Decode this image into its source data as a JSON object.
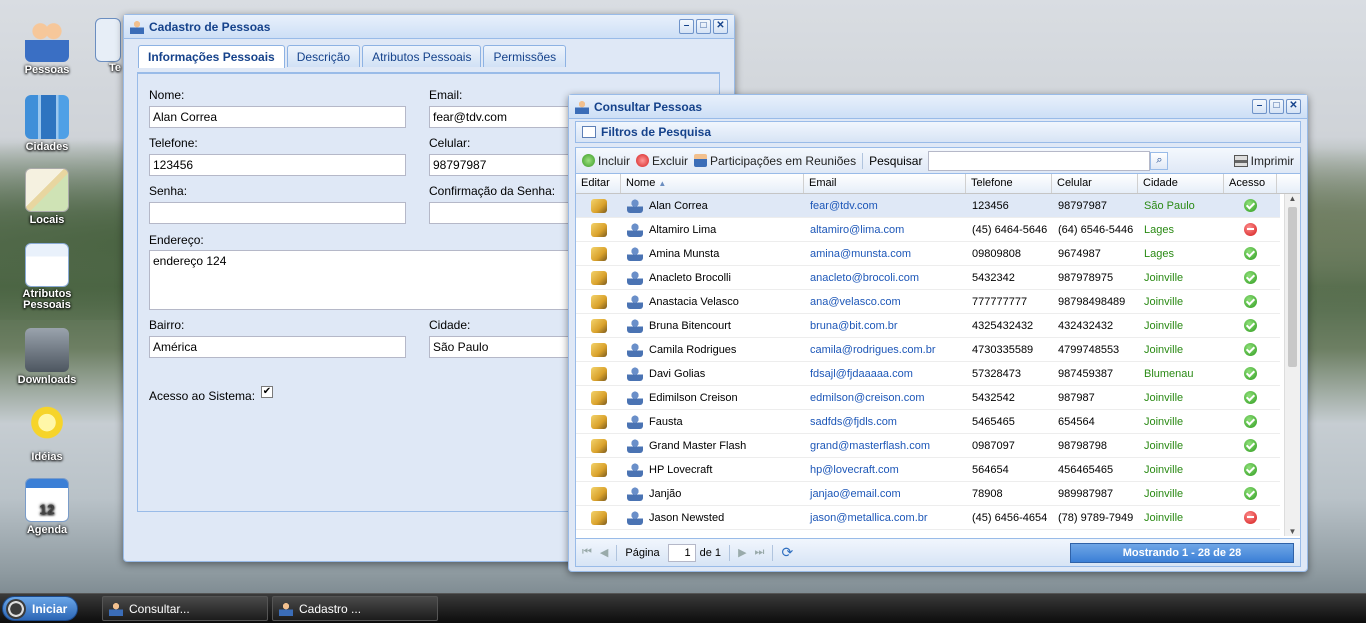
{
  "desktop": {
    "icons": [
      {
        "label": "Pessoas"
      },
      {
        "label": "Cidades"
      },
      {
        "label": "Locais"
      },
      {
        "label": "Atributos Pessoais"
      },
      {
        "label": "Downloads"
      },
      {
        "label": "Idéias"
      },
      {
        "label": "Agenda"
      }
    ],
    "partial_icon_label": "Te"
  },
  "cadastro": {
    "title": "Cadastro de Pessoas",
    "tabs": [
      "Informações Pessoais",
      "Descrição",
      "Atributos Pessoais",
      "Permissões"
    ],
    "fields": {
      "nome_label": "Nome:",
      "nome_value": "Alan Correa",
      "email_label": "Email:",
      "email_value": "fear@tdv.com",
      "telefone_label": "Telefone:",
      "telefone_value": "123456",
      "celular_label": "Celular:",
      "celular_value": "98797987",
      "senha_label": "Senha:",
      "senha_value": "",
      "confirmacao_label": "Confirmação da Senha:",
      "confirmacao_value": "",
      "endereco_label": "Endereço:",
      "endereco_value": "endereço 124",
      "bairro_label": "Bairro:",
      "bairro_value": "América",
      "cidade_label": "Cidade:",
      "cidade_value": "São Paulo",
      "acesso_label": "Acesso ao Sistema:"
    }
  },
  "consultar": {
    "title": "Consultar Pessoas",
    "filter_title": "Filtros de Pesquisa",
    "toolbar": {
      "incluir": "Incluir",
      "excluir": "Excluir",
      "participacoes": "Participações em Reuniões",
      "pesquisar": "Pesquisar",
      "imprimir": "Imprimir"
    },
    "columns": [
      "Editar",
      "Nome",
      "Email",
      "Telefone",
      "Celular",
      "Cidade",
      "Acesso"
    ],
    "rows": [
      {
        "nome": "Alan Correa",
        "email": "fear@tdv.com",
        "telefone": "123456",
        "celular": "98797987",
        "cidade": "São Paulo",
        "acesso": "ok"
      },
      {
        "nome": "Altamiro Lima",
        "email": "altamiro@lima.com",
        "telefone": "(45) 6464-5646",
        "celular": "(64) 6546-5446",
        "cidade": "Lages",
        "acesso": "no"
      },
      {
        "nome": "Amina Munsta",
        "email": "amina@munsta.com",
        "telefone": "09809808",
        "celular": "9674987",
        "cidade": "Lages",
        "acesso": "ok"
      },
      {
        "nome": "Anacleto Brocolli",
        "email": "anacleto@brocoli.com",
        "telefone": "5432342",
        "celular": "987978975",
        "cidade": "Joinville",
        "acesso": "ok"
      },
      {
        "nome": "Anastacia Velasco",
        "email": "ana@velasco.com",
        "telefone": "777777777",
        "celular": "98798498489",
        "cidade": "Joinville",
        "acesso": "ok"
      },
      {
        "nome": "Bruna Bitencourt",
        "email": "bruna@bit.com.br",
        "telefone": "4325432432",
        "celular": "432432432",
        "cidade": "Joinville",
        "acesso": "ok"
      },
      {
        "nome": "Camila Rodrigues",
        "email": "camila@rodrigues.com.br",
        "telefone": "4730335589",
        "celular": "4799748553",
        "cidade": "Joinville",
        "acesso": "ok"
      },
      {
        "nome": "Davi Golias",
        "email": "fdsajl@fjdaaaaa.com",
        "telefone": "57328473",
        "celular": "987459387",
        "cidade": "Blumenau",
        "acesso": "ok"
      },
      {
        "nome": "Edimilson Creison",
        "email": "edmilson@creison.com",
        "telefone": "5432542",
        "celular": "987987",
        "cidade": "Joinville",
        "acesso": "ok"
      },
      {
        "nome": "Fausta",
        "email": "sadfds@fjdls.com",
        "telefone": "5465465",
        "celular": "654564",
        "cidade": "Joinville",
        "acesso": "ok"
      },
      {
        "nome": "Grand Master Flash",
        "email": "grand@masterflash.com",
        "telefone": "0987097",
        "celular": "98798798",
        "cidade": "Joinville",
        "acesso": "ok"
      },
      {
        "nome": "HP Lovecraft",
        "email": "hp@lovecraft.com",
        "telefone": "564654",
        "celular": "456465465",
        "cidade": "Joinville",
        "acesso": "ok"
      },
      {
        "nome": "Janjão",
        "email": "janjao@email.com",
        "telefone": "78908",
        "celular": "989987987",
        "cidade": "Joinville",
        "acesso": "ok"
      },
      {
        "nome": "Jason Newsted",
        "email": "jason@metallica.com.br",
        "telefone": "(45) 6456-4654",
        "celular": "(78) 9789-7949",
        "cidade": "Joinville",
        "acesso": "no"
      }
    ],
    "pager": {
      "pagina_label": "Página",
      "page_value": "1",
      "de_label": "de 1",
      "status": "Mostrando 1 - 28 de 28"
    }
  },
  "taskbar": {
    "start_label": "Iniciar",
    "tasks": [
      "Consultar...",
      "Cadastro ..."
    ]
  }
}
